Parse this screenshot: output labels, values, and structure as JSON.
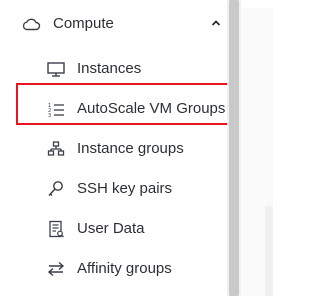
{
  "section": {
    "label": "Compute",
    "icon": "cloud-icon",
    "expanded": true,
    "toggle_icon": "chevron-up-icon"
  },
  "items": [
    {
      "label": "Instances",
      "icon": "monitor-icon"
    },
    {
      "label": "AutoScale VM Groups",
      "icon": "ordered-list-icon",
      "highlighted": true
    },
    {
      "label": "Instance groups",
      "icon": "cluster-icon"
    },
    {
      "label": "SSH key pairs",
      "icon": "key-icon"
    },
    {
      "label": "User Data",
      "icon": "document-icon"
    },
    {
      "label": "Affinity groups",
      "icon": "swap-arrows-icon"
    }
  ],
  "colors": {
    "text": "#2b2f36",
    "icon": "#3a3f47",
    "highlight_border": "#e8141f",
    "scrollbar_thumb": "#c9c9c9"
  }
}
